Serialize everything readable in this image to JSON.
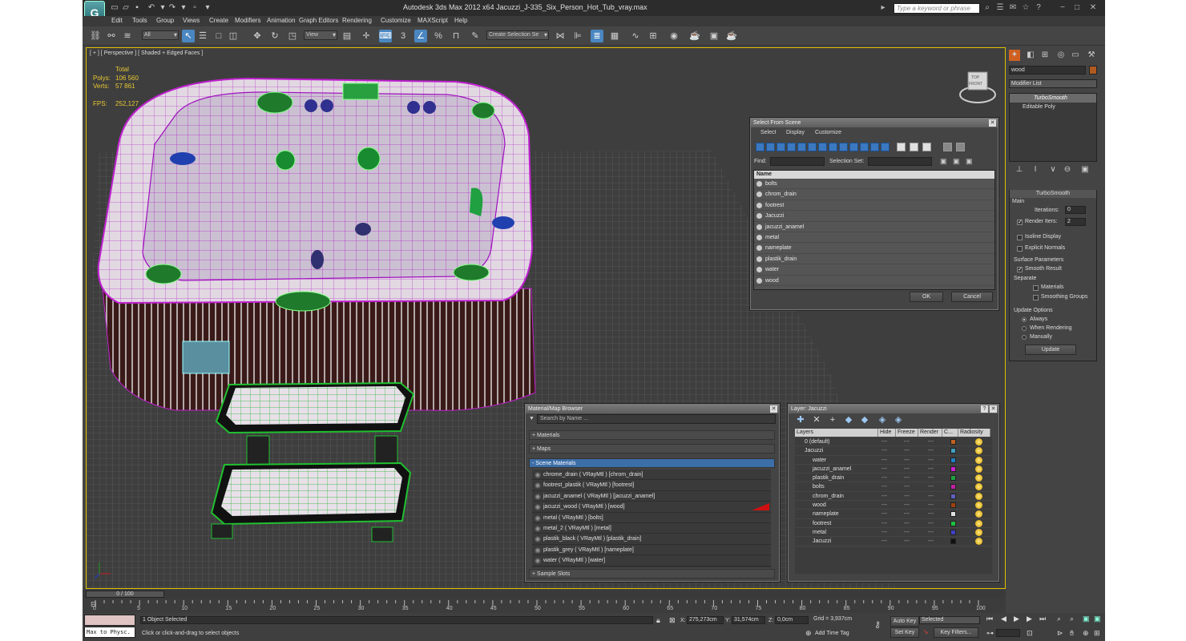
{
  "app": {
    "title": "Autodesk 3ds Max  2012 x64     Jacuzzi_J-335_Six_Person_Hot_Tub_vray.max",
    "search_placeholder": "Type a keyword or phrase"
  },
  "menu": [
    "Edit",
    "Tools",
    "Group",
    "Views",
    "Create",
    "Modifiers",
    "Animation",
    "Graph Editors",
    "Rendering",
    "Customize",
    "MAXScript",
    "Help"
  ],
  "toolbar": {
    "selection_filter": "All",
    "ref_coord": "View",
    "named_selection": "Create Selection Se"
  },
  "viewport": {
    "label": "[ + ] [ Perspective ] [ Shaded + Edged Faces ]",
    "stats_header": "Total",
    "polys_label": "Polys:",
    "polys_value": "106 560",
    "verts_label": "Verts:",
    "verts_value": "57 861",
    "fps_label": "FPS:",
    "fps_value": "252,127",
    "cube_face": "TOP",
    "cube_face2": "FRONT"
  },
  "select_from_scene": {
    "title": "Select From Scene",
    "menu": [
      "Select",
      "Display",
      "Customize"
    ],
    "find_label": "Find:",
    "selection_set_label": "Selection Set:",
    "column_name": "Name",
    "items": [
      "bolts",
      "chrom_drain",
      "footrest",
      "Jacuzzi",
      "jacuzzi_anamel",
      "metal",
      "nameplate",
      "plastik_drain",
      "water",
      "wood"
    ],
    "ok": "OK",
    "cancel": "Cancel"
  },
  "material_browser": {
    "title": "Material/Map Browser",
    "search_placeholder": "Search by Name ...",
    "sections": {
      "materials": "+ Materials",
      "maps": "+ Maps",
      "scene_materials": "- Scene Materials",
      "sample_slots": "+ Sample Slots"
    },
    "scene_materials": [
      "chrome_drain  ( VRayMtl ) [chrom_drain]",
      "footrest_plastik ( VRayMtl ) [footrest]",
      "jacuzzi_anamel  ( VRayMtl ) [jacuzzi_anamel]",
      "jacuzzi_wood  ( VRayMtl ) [wood]",
      "metal  ( VRayMtl ) [bolts]",
      "metal_2  ( VRayMtl ) [metal]",
      "plastik_black  ( VRayMtl ) [plastik_drain]",
      "plastik_grey  ( VRayMtl ) [nameplate]",
      "water  ( VRayMtl ) [water]"
    ]
  },
  "layer_manager": {
    "title": "Layer: Jacuzzi",
    "columns": {
      "layers": "Layers",
      "hide": "Hide",
      "freeze": "Freeze",
      "render": "Render",
      "color": "C...",
      "radiosity": "Radiosity"
    },
    "rows": [
      {
        "name": "0 (default)",
        "indent": 0,
        "color": "#c06020"
      },
      {
        "name": "Jacuzzi",
        "indent": 0,
        "color": "#40a0c0"
      },
      {
        "name": "water",
        "indent": 1,
        "color": "#2080c0"
      },
      {
        "name": "jacuzzi_anamel",
        "indent": 1,
        "color": "#d020d0"
      },
      {
        "name": "plastik_drain",
        "indent": 1,
        "color": "#20a040"
      },
      {
        "name": "bolts",
        "indent": 1,
        "color": "#c020a0"
      },
      {
        "name": "chrom_drain",
        "indent": 1,
        "color": "#6060c0"
      },
      {
        "name": "wood",
        "indent": 1,
        "color": "#a04010"
      },
      {
        "name": "nameplate",
        "indent": 1,
        "color": "#e0e0e0"
      },
      {
        "name": "footrest",
        "indent": 1,
        "color": "#20c040"
      },
      {
        "name": "metal",
        "indent": 1,
        "color": "#4040c0"
      },
      {
        "name": "Jacuzzi",
        "indent": 1,
        "color": "#101010"
      }
    ]
  },
  "command_panel": {
    "object_name": "wood",
    "modifier_list": "Modifier List",
    "stack": [
      "TurboSmooth",
      "Editable Poly"
    ],
    "rollout_title": "TurboSmooth",
    "main_label": "Main",
    "iterations_label": "Iterations:",
    "iterations_value": "0",
    "render_iters_label": "Render Iters:",
    "render_iters_value": "2",
    "isoline_display": "Isoline Display",
    "explicit_normals": "Explicit Normals",
    "surface_params": "Surface Parameters",
    "smooth_result": "Smooth Result",
    "separate": "Separate",
    "materials": "Materials",
    "smoothing_groups": "Smoothing Groups",
    "update_options": "Update Options",
    "always": "Always",
    "when_rendering": "When Rendering",
    "manually": "Manually",
    "update_button": "Update"
  },
  "timeline": {
    "frame": "0 / 100",
    "ticks": [
      "0",
      "5",
      "10",
      "15",
      "20",
      "25",
      "30",
      "35",
      "40",
      "45",
      "50",
      "55",
      "60",
      "65",
      "70",
      "75",
      "80",
      "85",
      "90",
      "95",
      "100"
    ]
  },
  "status": {
    "maxscript": "Max to Physc.",
    "selected": "1 Object Selected",
    "prompt": "Click or click-and-drag to select objects",
    "x_label": "X:",
    "x_value": "275,273cm",
    "y_label": "Y:",
    "y_value": "31,574cm",
    "z_label": "Z:",
    "z_value": "0,0cm",
    "grid": "Grid = 3,937cm",
    "add_time_tag": "Add Time Tag",
    "auto_key": "Auto Key",
    "set_key": "Set Key",
    "key_mode": "Selected",
    "key_filters": "Key Filters..."
  }
}
